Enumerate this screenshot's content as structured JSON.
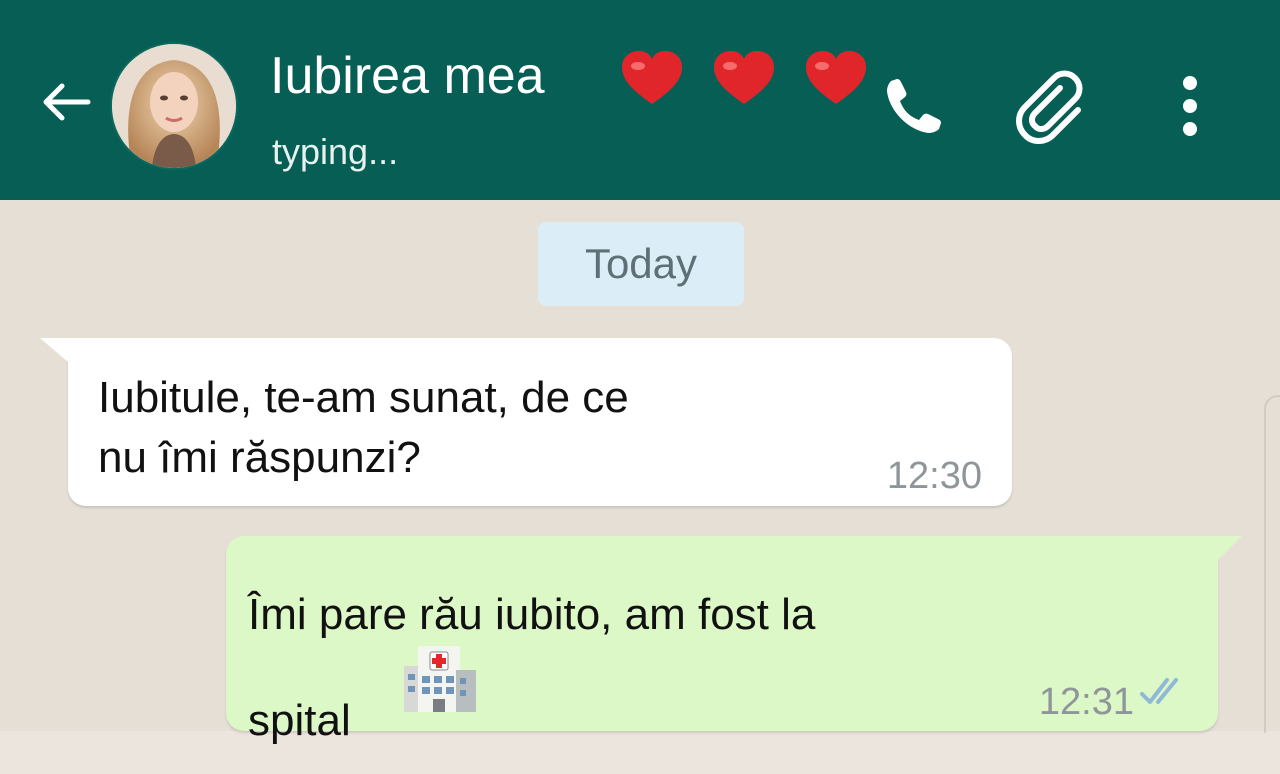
{
  "header": {
    "contact_name": "Iubirea mea",
    "status": "typing...",
    "back_icon": "back-arrow-icon",
    "call_icon": "phone-icon",
    "attach_icon": "paperclip-icon",
    "menu_icon": "more-vertical-icon",
    "hearts": 3,
    "colors": {
      "header": "#075e54",
      "heart": "#e0262a"
    }
  },
  "chat": {
    "date_label": "Today",
    "messages": [
      {
        "direction": "incoming",
        "text": "Iubitule, te-am sunat, de ce\nnu îmi răspunzi?",
        "time": "12:30"
      },
      {
        "direction": "outgoing",
        "text": "Îmi pare rău iubito, am fost la\nspital",
        "time": "12:31",
        "emoji": "hospital-emoji",
        "status": "delivered-double-check"
      }
    ],
    "colors": {
      "incoming": "#ffffff",
      "outgoing": "#dcf8c6",
      "date_chip": "#dbeef7"
    }
  }
}
